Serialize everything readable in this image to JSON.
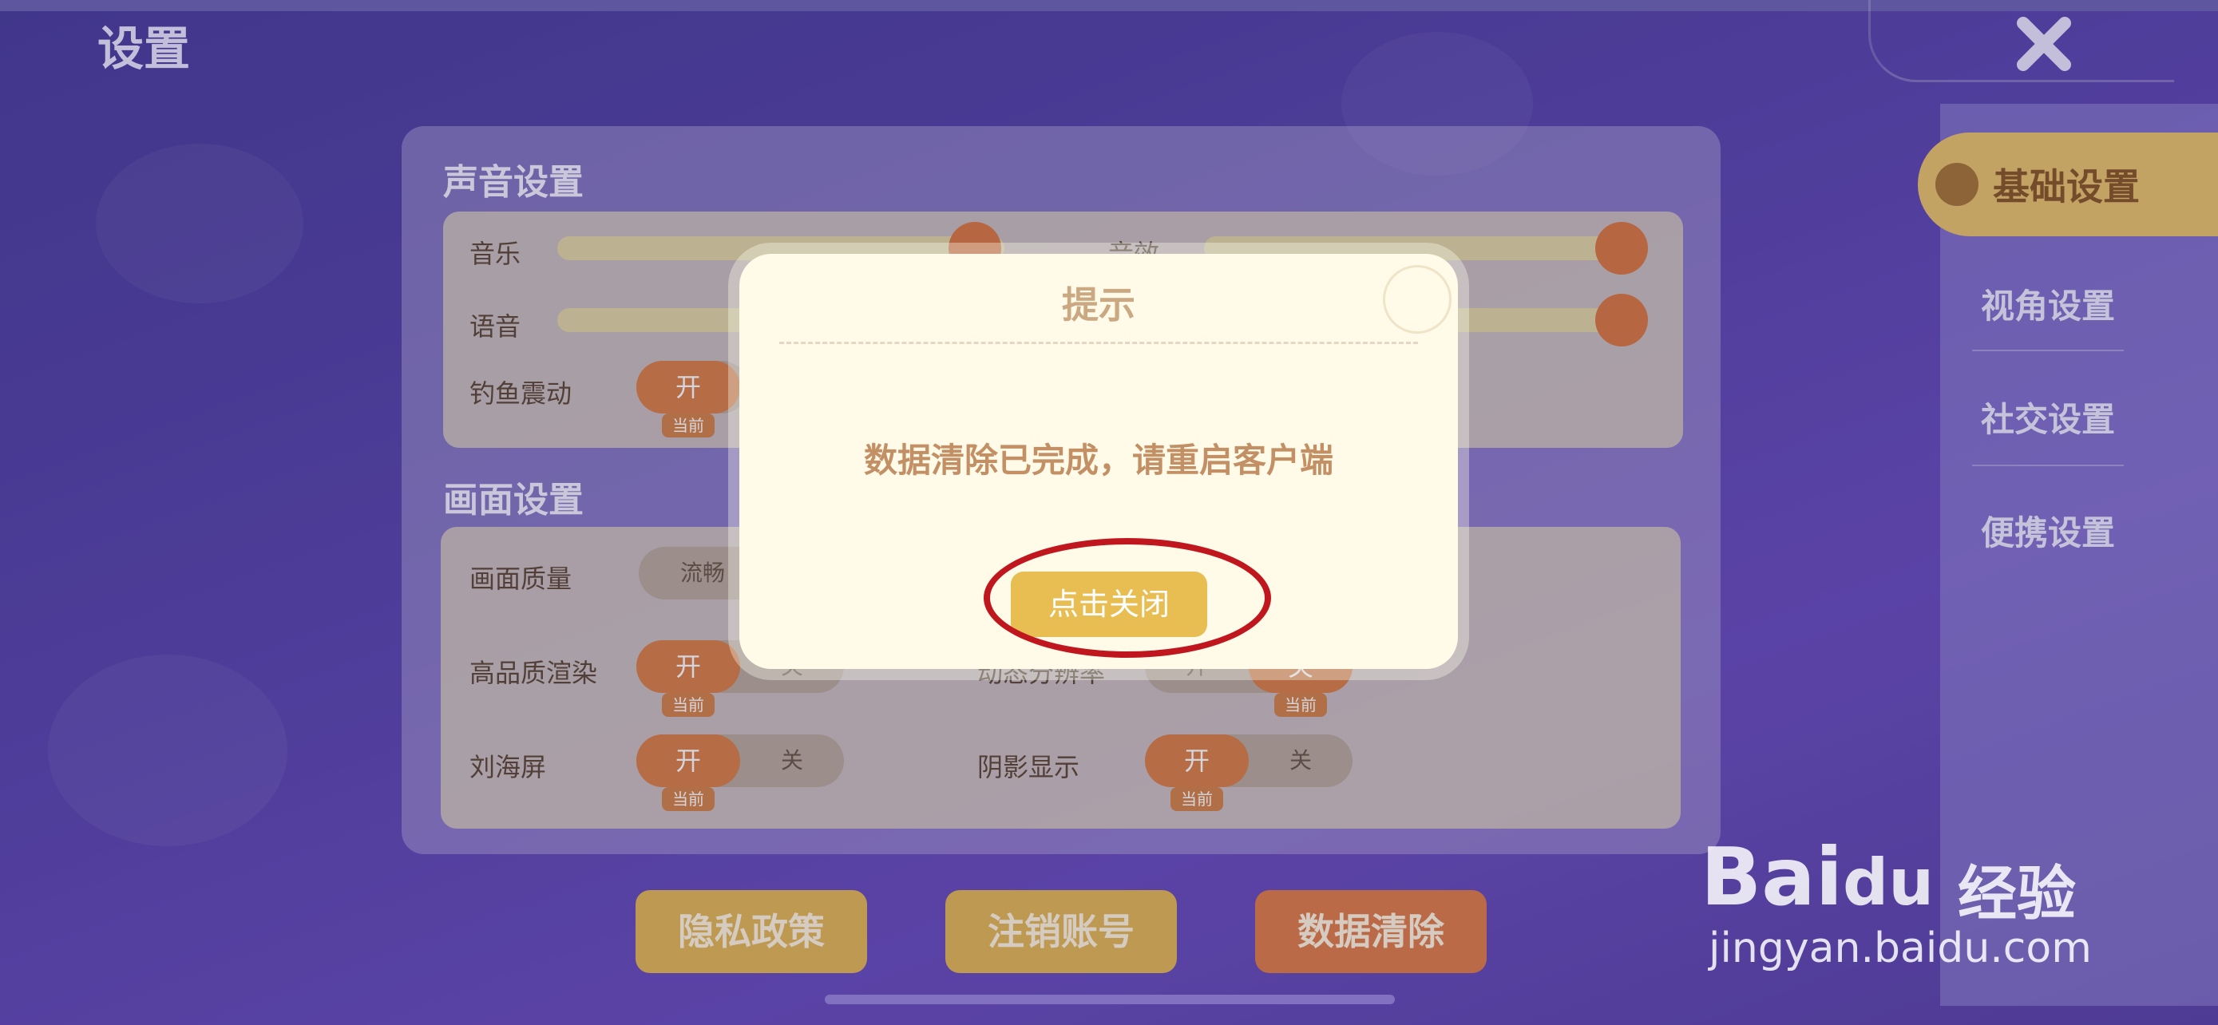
{
  "header": {
    "title": "设置"
  },
  "sidebar": {
    "items": [
      {
        "label": "基础设置",
        "active": true
      },
      {
        "label": "视角设置"
      },
      {
        "label": "社交设置"
      },
      {
        "label": "便携设置"
      }
    ]
  },
  "sound": {
    "title": "声音设置",
    "music_label": "音乐",
    "sfx_label": "音效",
    "voice_label": "语音",
    "vibration_label": "钓鱼震动",
    "vibration_on": "开",
    "vibration_current": "当前"
  },
  "graphics": {
    "title": "画面设置",
    "quality_label": "画面质量",
    "quality_option": "流畅",
    "hq_label": "高品质渲染",
    "hq_on": "开",
    "hq_off": "关",
    "hq_current": "当前",
    "dyn_label": "动态分辨率",
    "dyn_on": "开",
    "dyn_off": "关",
    "dyn_current": "当前",
    "notch_label": "刘海屏",
    "notch_on": "开",
    "notch_off": "关",
    "notch_current": "当前",
    "shadow_label": "阴影显示",
    "shadow_on": "开",
    "shadow_off": "关",
    "shadow_current": "当前"
  },
  "bottom": {
    "privacy": "隐私政策",
    "logout": "注销账号",
    "clear": "数据清除"
  },
  "dialog": {
    "title": "提示",
    "message": "数据清除已完成，请重启客户端",
    "button": "点击关闭"
  },
  "watermark": {
    "brand": "Bai",
    "brand2": "du",
    "suffix": "经验",
    "url": "jingyan.baidu.com"
  },
  "colors": {
    "accent": "#d9804a",
    "annotation": "#c0171f",
    "tab_active": "#e8c46e"
  }
}
